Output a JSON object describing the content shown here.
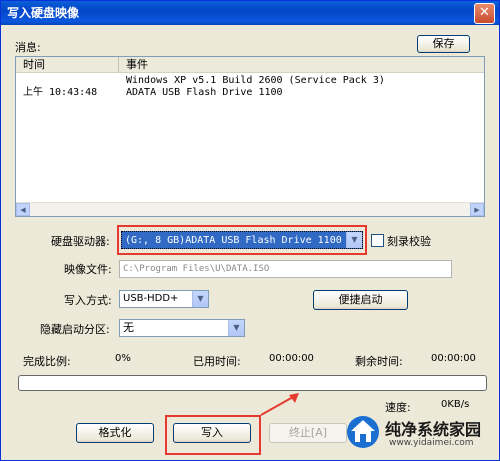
{
  "window": {
    "title": "写入硬盘映像",
    "close_glyph": "✕"
  },
  "message_label": "消息:",
  "save_button": "保存",
  "log": {
    "columns": [
      "时间",
      "事件"
    ],
    "rows": [
      {
        "time": "",
        "event": "Windows XP v5.1 Build 2600 (Service Pack 3)"
      },
      {
        "time": "上午 10:43:48",
        "event": "ADATA    USB Flash Drive 1100"
      }
    ]
  },
  "drive": {
    "label": "硬盘驱动器:",
    "value": "(G:, 8 GB)ADATA   USB Flash Drive 1100"
  },
  "verify": {
    "label": "刻录校验",
    "checked": false
  },
  "image_file": {
    "label": "映像文件:",
    "value": "C:\\Program Files\\U\\DATA.ISO"
  },
  "write_mode": {
    "label": "写入方式:",
    "value": "USB-HDD+"
  },
  "quick_boot_button": "便捷启动",
  "hide_partition": {
    "label": "隐藏启动分区:",
    "value": "无"
  },
  "stats": {
    "complete_label": "完成比例:",
    "complete_value": "0%",
    "elapsed_label": "已用时间:",
    "elapsed_value": "00:00:00",
    "remaining_label": "剩余时间:",
    "remaining_value": "00:00:00",
    "speed_label": "速度:",
    "speed_value": "0KB/s"
  },
  "progress_fraction": 0,
  "buttons": {
    "format": "格式化",
    "write": "写入",
    "stop": "终止[A]"
  },
  "watermark": {
    "brand": "纯净系统家园",
    "url": "www.yidaimei.com"
  },
  "colors": {
    "highlight": "#e53a2f",
    "title_bar": "#0a57dc",
    "selection": "#316ac5"
  }
}
